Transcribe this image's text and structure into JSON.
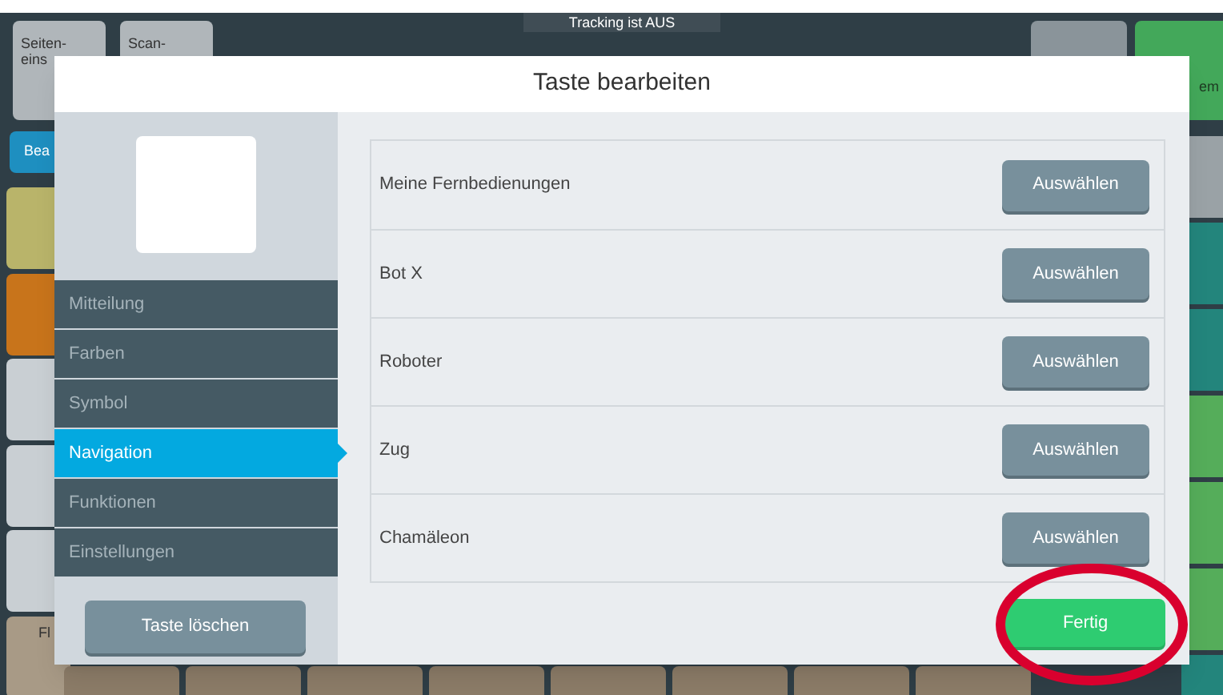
{
  "background": {
    "tracking_status": "Tracking ist AUS",
    "top_buttons": [
      {
        "label": "Seiten-\neins"
      },
      {
        "label": "Scan-"
      }
    ],
    "tab_label": "Bea",
    "right_label": "em",
    "corner_label": "Fl"
  },
  "dialog": {
    "title": "Taste bearbeiten",
    "nav": [
      {
        "label": "Mitteilung",
        "selected": false
      },
      {
        "label": "Farben",
        "selected": false
      },
      {
        "label": "Symbol",
        "selected": false
      },
      {
        "label": "Navigation",
        "selected": true
      },
      {
        "label": "Funktionen",
        "selected": false
      },
      {
        "label": "Einstellungen",
        "selected": false
      }
    ],
    "delete_button": "Taste löschen",
    "rows": [
      {
        "label": "Meine Fernbedienungen",
        "button": "Auswählen"
      },
      {
        "label": "Bot X",
        "button": "Auswählen"
      },
      {
        "label": "Roboter",
        "button": "Auswählen"
      },
      {
        "label": "Zug",
        "button": "Auswählen"
      },
      {
        "label": "Chamäleon",
        "button": "Auswählen"
      }
    ],
    "done_button": "Fertig"
  }
}
